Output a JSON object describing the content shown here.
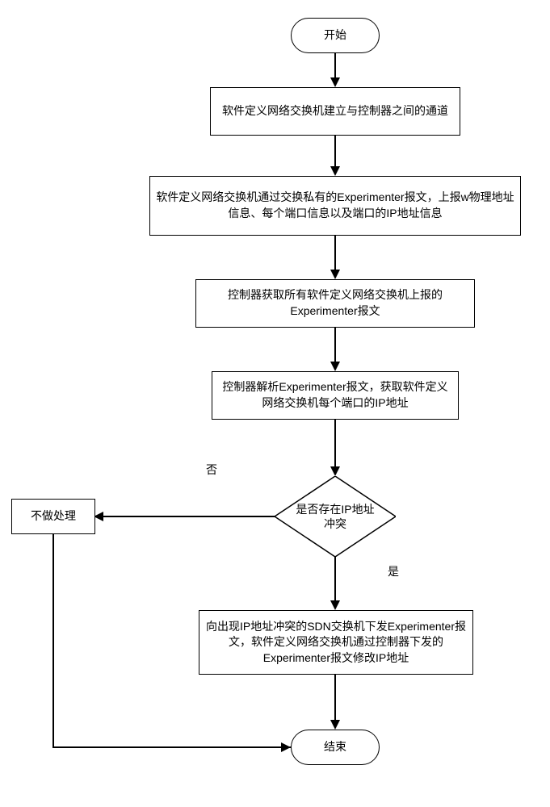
{
  "nodes": {
    "start": "开始",
    "step1": "软件定义网络交换机建立与控制器之间的通道",
    "step2": "软件定义网络交换机通过交换私有的Experimenter报文，上报w物理地址信息、每个端口信息以及端口的IP地址信息",
    "step3": "控制器获取所有软件定义网络交换机上报的Experimenter报文",
    "step4": "控制器解析Experimenter报文，获取软件定义网络交换机每个端口的IP地址",
    "decision": "是否存在IP地址冲突",
    "noop": "不做处理",
    "step5": "向出现IP地址冲突的SDN交换机下发Experimenter报文，软件定义网络交换机通过控制器下发的Experimenter报文修改IP地址",
    "end": "结束"
  },
  "labels": {
    "no": "否",
    "yes": "是"
  }
}
